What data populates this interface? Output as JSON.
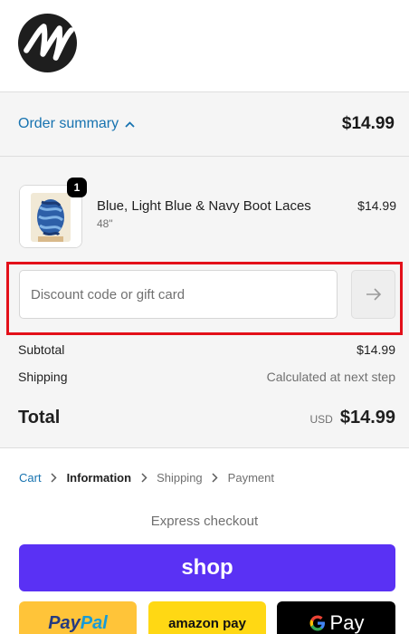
{
  "brand": {
    "logo_icon": "brand-logo-icon"
  },
  "order_summary": {
    "toggle_label": "Order summary",
    "toggle_icon": "chevron-up-icon",
    "total": "$14.99"
  },
  "line_item": {
    "quantity": "1",
    "name": "Blue, Light Blue & Navy Boot Laces",
    "variant": "48\"",
    "price": "$14.99"
  },
  "discount": {
    "placeholder": "Discount code or gift card",
    "value": "",
    "apply_icon": "arrow-right-icon"
  },
  "totals": {
    "subtotal_label": "Subtotal",
    "subtotal_value": "$14.99",
    "shipping_label": "Shipping",
    "shipping_value": "Calculated at next step",
    "total_label": "Total",
    "currency": "USD",
    "total_value": "$14.99"
  },
  "breadcrumb": {
    "cart": "Cart",
    "information": "Information",
    "shipping": "Shipping",
    "payment": "Payment"
  },
  "express": {
    "label": "Express checkout",
    "shop_pay": "shop",
    "paypal_part1": "Pay",
    "paypal_part2": "Pal",
    "amazon_pay": "amazon pay",
    "google_pay": "Pay"
  },
  "colors": {
    "accent": "#1773b0",
    "shop_pay": "#5a31f4",
    "paypal": "#ffc439",
    "amazon": "#ffd814",
    "highlight": "#e3101a"
  }
}
